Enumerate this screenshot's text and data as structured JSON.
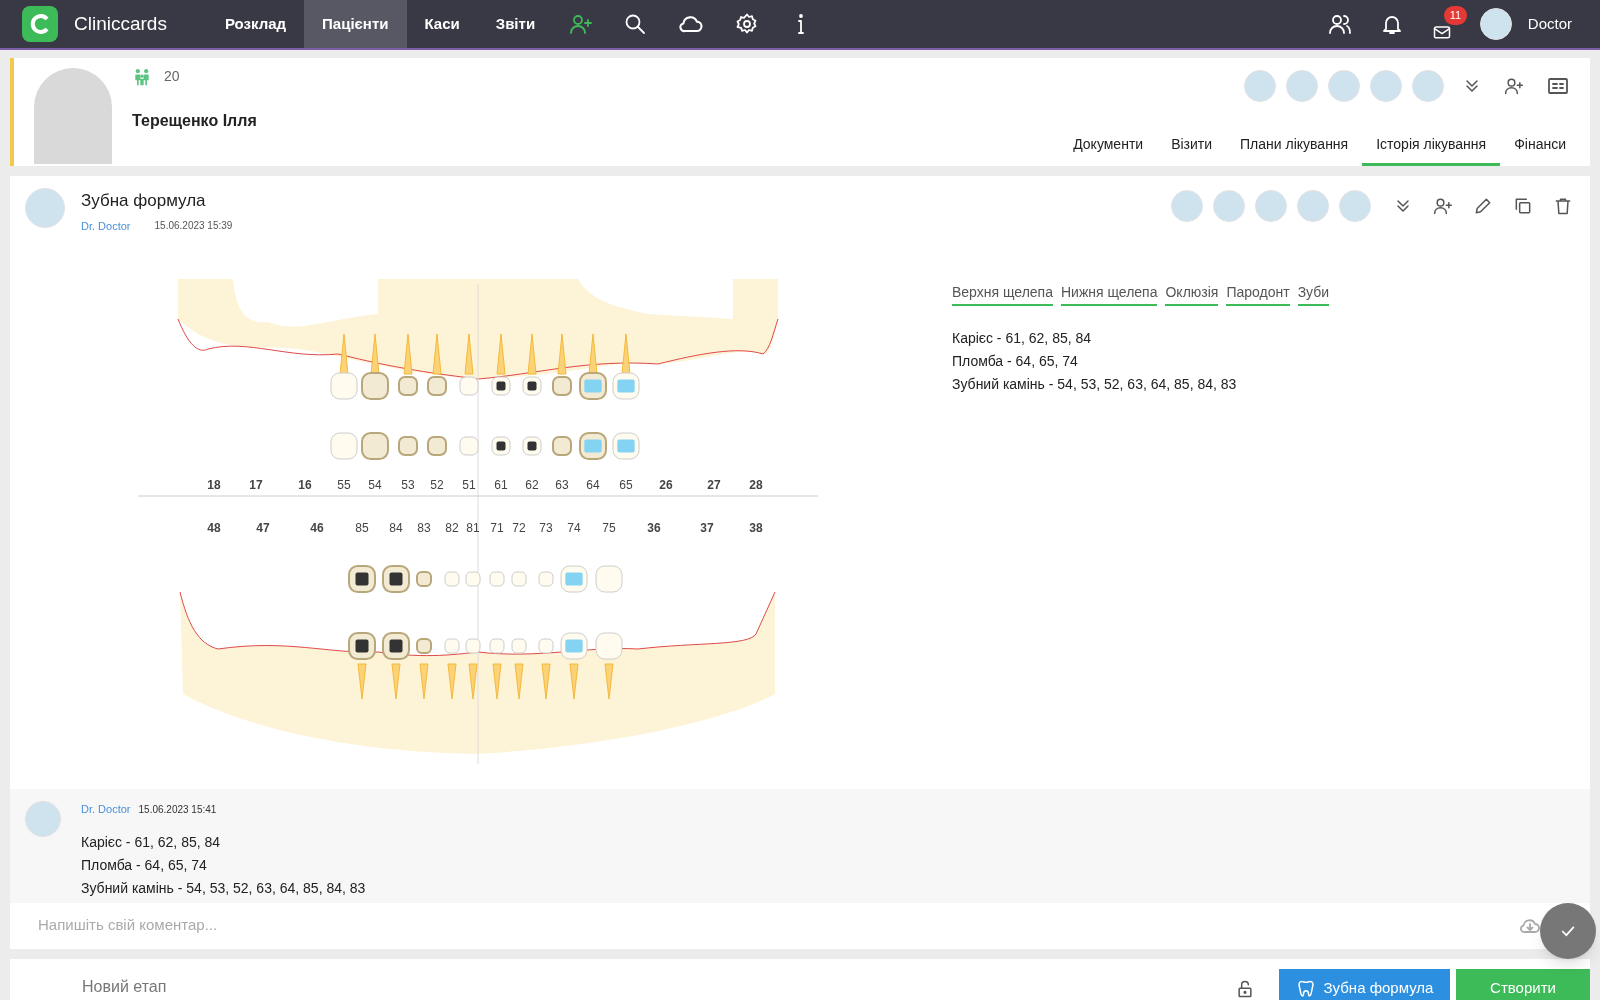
{
  "nav": {
    "brand": "Cliniccards",
    "items": [
      {
        "label": "Розклад",
        "selected": false
      },
      {
        "label": "Пацієнти",
        "selected": true
      },
      {
        "label": "Каси",
        "selected": false
      },
      {
        "label": "Звіти",
        "selected": false
      }
    ],
    "mail_count": "11",
    "user": "Doctor"
  },
  "patient": {
    "family_count": "20",
    "name": "Терещенко Ілля",
    "tabs": [
      {
        "label": "Документи",
        "selected": false
      },
      {
        "label": "Візити",
        "selected": false
      },
      {
        "label": "Плани лікування",
        "selected": false
      },
      {
        "label": "Історія лікування",
        "selected": true
      },
      {
        "label": "Фінанси",
        "selected": false
      }
    ]
  },
  "record": {
    "title": "Зубна формула",
    "author": "Dr. Doctor",
    "date": "15.06.2023 15:39",
    "upper_teeth": [
      {
        "number": "18",
        "kind": "permanent"
      },
      {
        "number": "17",
        "kind": "permanent"
      },
      {
        "number": "16",
        "kind": "permanent"
      },
      {
        "number": "55",
        "kind": "primary",
        "caries": false,
        "filling": false,
        "calculus": false
      },
      {
        "number": "54",
        "kind": "primary",
        "caries": false,
        "filling": false,
        "calculus": true
      },
      {
        "number": "53",
        "kind": "primary",
        "caries": false,
        "filling": false,
        "calculus": true
      },
      {
        "number": "52",
        "kind": "primary",
        "caries": false,
        "filling": false,
        "calculus": true
      },
      {
        "number": "51",
        "kind": "primary",
        "caries": false,
        "filling": false,
        "calculus": false
      },
      {
        "number": "61",
        "kind": "primary",
        "caries": true,
        "filling": false,
        "calculus": false
      },
      {
        "number": "62",
        "kind": "primary",
        "caries": true,
        "filling": false,
        "calculus": false
      },
      {
        "number": "63",
        "kind": "primary",
        "caries": false,
        "filling": false,
        "calculus": true
      },
      {
        "number": "64",
        "kind": "primary",
        "caries": false,
        "filling": true,
        "calculus": true
      },
      {
        "number": "65",
        "kind": "primary",
        "caries": false,
        "filling": true,
        "calculus": false
      },
      {
        "number": "26",
        "kind": "permanent"
      },
      {
        "number": "27",
        "kind": "permanent"
      },
      {
        "number": "28",
        "kind": "permanent"
      }
    ],
    "lower_teeth": [
      {
        "number": "48",
        "kind": "permanent"
      },
      {
        "number": "47",
        "kind": "permanent"
      },
      {
        "number": "46",
        "kind": "permanent"
      },
      {
        "number": "85",
        "kind": "primary",
        "caries": true,
        "filling": false,
        "calculus": true
      },
      {
        "number": "84",
        "kind": "primary",
        "caries": true,
        "filling": false,
        "calculus": true
      },
      {
        "number": "83",
        "kind": "primary",
        "caries": false,
        "filling": false,
        "calculus": true
      },
      {
        "number": "82",
        "kind": "primary",
        "caries": false,
        "filling": false,
        "calculus": false
      },
      {
        "number": "81",
        "kind": "primary",
        "caries": false,
        "filling": false,
        "calculus": false
      },
      {
        "number": "71",
        "kind": "primary",
        "caries": false,
        "filling": false,
        "calculus": false
      },
      {
        "number": "72",
        "kind": "primary",
        "caries": false,
        "filling": false,
        "calculus": false
      },
      {
        "number": "73",
        "kind": "primary",
        "caries": false,
        "filling": false,
        "calculus": false
      },
      {
        "number": "74",
        "kind": "primary",
        "caries": false,
        "filling": true,
        "calculus": false
      },
      {
        "number": "75",
        "kind": "primary",
        "caries": false,
        "filling": false,
        "calculus": false
      },
      {
        "number": "36",
        "kind": "permanent"
      },
      {
        "number": "37",
        "kind": "permanent"
      },
      {
        "number": "38",
        "kind": "permanent"
      }
    ],
    "view_links": [
      "Верхня щелепа",
      "Нижня щелепа",
      "Оклюзія",
      "Пародонт",
      "Зуби"
    ],
    "summary": [
      "Карієс - 61, 62, 85, 84",
      "Пломба - 64, 65, 74",
      "Зубний камінь - 54, 53, 52, 63, 64, 85, 84, 83"
    ]
  },
  "comment": {
    "author": "Dr. Doctor",
    "date": "15.06.2023 15:41",
    "lines": [
      "Карієс - 61, 62, 85, 84",
      "Пломба - 64, 65, 74",
      "Зубний камінь - 54, 53, 52, 63, 64, 85, 84, 83"
    ],
    "placeholder": "Напишіть свій коментар..."
  },
  "footer": {
    "placeholder": "Новий етап",
    "buttons": [
      "Зубна формула",
      "Створити"
    ]
  }
}
